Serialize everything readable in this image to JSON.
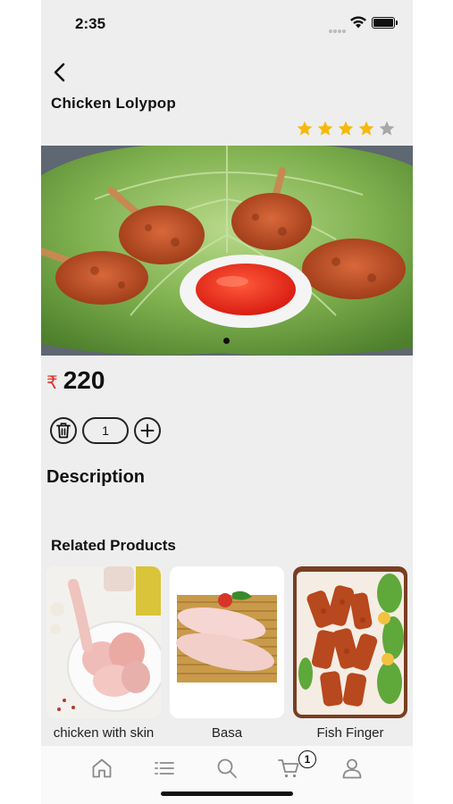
{
  "status_bar": {
    "time": "2:35"
  },
  "product": {
    "title": "Chicken Lolypop",
    "rating": 4,
    "rating_max": 5,
    "currency_symbol": "₹",
    "price": "220",
    "quantity": "1"
  },
  "sections": {
    "description_title": "Description",
    "related_title": "Related Products"
  },
  "related_products": [
    {
      "name": "chicken with skin"
    },
    {
      "name": "Basa"
    },
    {
      "name": "Fish Finger"
    }
  ],
  "tab_bar": {
    "cart_count": "1",
    "tabs": [
      "home-icon",
      "list-icon",
      "search-icon",
      "cart-icon",
      "profile-icon"
    ]
  },
  "colors": {
    "star_filled": "#f5b90c",
    "star_empty": "#a8a8a8",
    "rupee": "#e0332b",
    "background": "#eeeeee"
  }
}
